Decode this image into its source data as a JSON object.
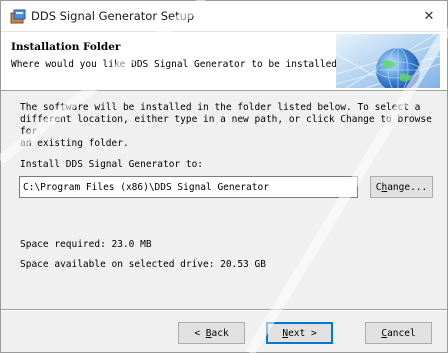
{
  "window": {
    "title": "DDS Signal Generator Setup",
    "close_glyph": "✕"
  },
  "header": {
    "title": "Installation Folder",
    "subtitle": "Where would you like DDS Signal Generator to be installed?"
  },
  "body": {
    "description": "The software will be installed in the folder listed below. To select a\ndifferent location, either type in a new path, or click Change to browse for\nan existing folder.",
    "install_label": "Install DDS Signal Generator to:",
    "install_path": "C:\\Program Files (x86)\\DDS Signal Generator",
    "change_button": {
      "before": "C",
      "accel": "h",
      "after": "ange..."
    },
    "space_required": "Space required: 23.0 MB",
    "space_available": "Space available on selected drive: 20.53 GB"
  },
  "buttons": {
    "back": {
      "before": "< ",
      "accel": "B",
      "after": "ack"
    },
    "next": {
      "before": "",
      "accel": "N",
      "after": "ext >"
    },
    "cancel": {
      "before": "",
      "accel": "C",
      "after": "ancel"
    }
  },
  "icons": {
    "app": "installer-box-icon",
    "close": "close-icon",
    "banner": "globe-network-banner"
  },
  "colors": {
    "dialog_bg": "#f0f0f0",
    "header_bg": "#ffffff",
    "default_button_border": "#0078d7",
    "banner_blue": "#3f7fd0"
  }
}
